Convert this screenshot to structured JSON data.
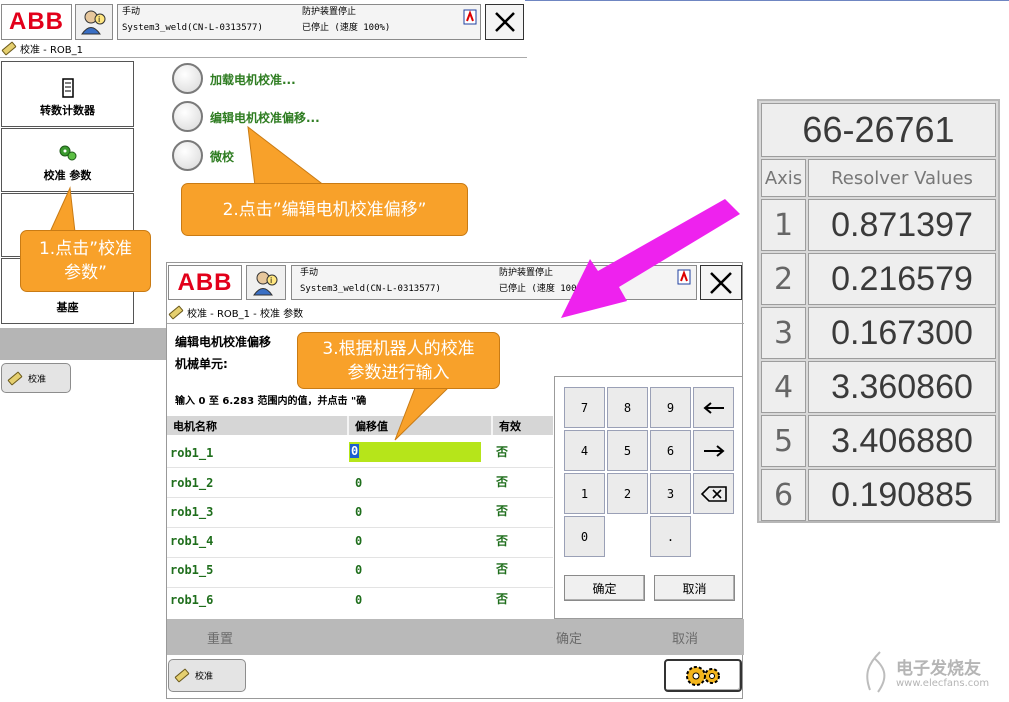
{
  "bg_window": {
    "header": {
      "mode": "手动",
      "system": "System3_weld(CN-L-0313577)",
      "guard": "防护装置停止",
      "state": "已停止 (速度 100%)"
    },
    "breadcrumb": "校准 - ROB_1",
    "nav": [
      "转数计数器",
      "校准 参数",
      "基座"
    ],
    "options": [
      "加载电机校准...",
      "编辑电机校准偏移...",
      "微校"
    ],
    "task_button": "校准"
  },
  "callouts": {
    "step1": "1.点击\"校准\n参数\"",
    "step1_line1": "1.点击”校准",
    "step1_line2": "参数”",
    "step2": "2.点击”编辑电机校准偏移”",
    "step3_line1": "3.根据机器人的校准",
    "step3_line2": "参数进行输入"
  },
  "front_window": {
    "header": {
      "mode": "手动",
      "system": "System3_weld(CN-L-0313577)",
      "guard": "防护装置停止",
      "state": "已停止 (速度 100"
    },
    "breadcrumb": "校准 - ROB_1 - 校准 参数",
    "title": "编辑电机校准偏移",
    "mech_unit": "机械单元:",
    "instruction": "输入 0 至 6.283 范围内的值，并点击 \"确",
    "columns": {
      "name": "电机名称",
      "offset": "偏移值",
      "valid": "有效"
    },
    "rows": [
      {
        "name": "rob1_1",
        "offset": "0",
        "valid": "否"
      },
      {
        "name": "rob1_2",
        "offset": "0",
        "valid": "否"
      },
      {
        "name": "rob1_3",
        "offset": "0",
        "valid": "否"
      },
      {
        "name": "rob1_4",
        "offset": "0",
        "valid": "否"
      },
      {
        "name": "rob1_5",
        "offset": "0",
        "valid": "否"
      },
      {
        "name": "rob1_6",
        "offset": "0",
        "valid": "否"
      }
    ],
    "keypad": {
      "keys": [
        "7",
        "8",
        "9",
        "4",
        "5",
        "6",
        "1",
        "2",
        "3",
        "0",
        "."
      ],
      "ok": "确定",
      "cancel": "取消"
    },
    "commands": {
      "reset": "重置",
      "ok": "确定",
      "cancel": "取消"
    },
    "task_button": "校准"
  },
  "resolver_table": {
    "serial": "66-26761",
    "col_axis": "Axis",
    "col_values": "Resolver Values",
    "rows": [
      {
        "axis": "1",
        "value": "0.871397"
      },
      {
        "axis": "2",
        "value": "0.216579"
      },
      {
        "axis": "3",
        "value": "0.167300"
      },
      {
        "axis": "4",
        "value": "3.360860"
      },
      {
        "axis": "5",
        "value": "3.406880"
      },
      {
        "axis": "6",
        "value": "0.190885"
      }
    ]
  },
  "watermark": {
    "cn": "电子发烧友",
    "url": "www.elecfans.com"
  },
  "colors": {
    "abb_red": "#e2001a",
    "callout": "#f8a12a",
    "arrow": "#ee22ee",
    "input_highlight": "#b6e51a"
  }
}
